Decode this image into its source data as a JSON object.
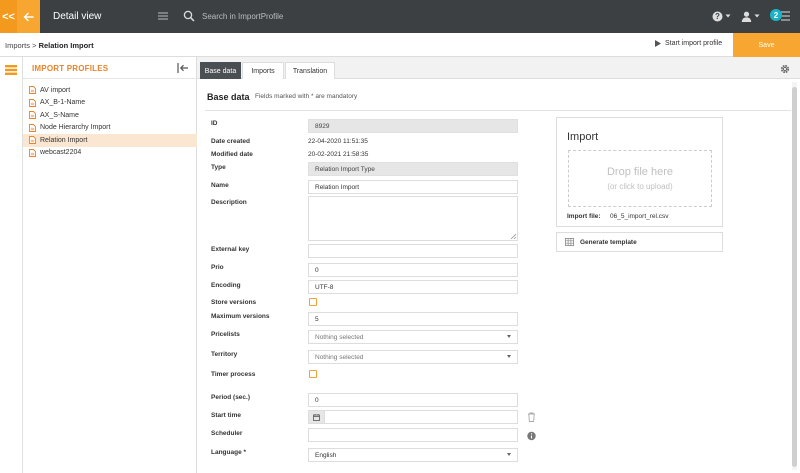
{
  "topbar": {
    "title": "Detail view",
    "collapse_label": "<<",
    "search_placeholder": "Search in ImportProfile",
    "notification_count": "2"
  },
  "breadcrumb": {
    "parent": "Imports",
    "separator": " > ",
    "current": "Relation Import"
  },
  "actions": {
    "start_label": "Start import profile",
    "save_label": "Save"
  },
  "sidebar": {
    "heading": "IMPORT PROFILES",
    "items": [
      {
        "label": "AV import"
      },
      {
        "label": "AX_B-1-Name"
      },
      {
        "label": "AX_S-Name"
      },
      {
        "label": "Node Hierarchy Import"
      },
      {
        "label": "Relation Import",
        "active": true
      },
      {
        "label": "webcast2204"
      }
    ]
  },
  "tabs": [
    {
      "label": "Base data",
      "active": true
    },
    {
      "label": "Imports"
    },
    {
      "label": "Translation"
    }
  ],
  "form": {
    "title": "Base data",
    "hint": "Fields marked with * are mandatory",
    "id_label": "ID",
    "id_value": "8929",
    "date_created_label": "Date created",
    "date_created_value": "22-04-2020 11:51:35",
    "modified_label": "Modified date",
    "modified_value": "20-02-2021 21:58:35",
    "type_label": "Type",
    "type_value": "Relation Import Type",
    "name_label": "Name",
    "name_value": "Relation Import",
    "description_label": "Description",
    "external_key_label": "External key",
    "prio_label": "Prio",
    "prio_value": "0",
    "encoding_label": "Encoding",
    "encoding_value": "UTF-8",
    "store_versions_label": "Store versions",
    "max_versions_label": "Maximum versions",
    "max_versions_value": "5",
    "pricelists_label": "Pricelists",
    "pricelists_value": "Nothing selected",
    "territory_label": "Territory",
    "territory_value": "Nothing selected",
    "timer_label": "Timer process",
    "period_label": "Period (sec.)",
    "period_value": "0",
    "start_time_label": "Start time",
    "scheduler_label": "Scheduler",
    "language_label": "Language *",
    "language_value": "English"
  },
  "import_card": {
    "title": "Import",
    "drop_main": "Drop file here",
    "drop_sub": "(or click to upload)",
    "file_label": "Import file:",
    "file_value": "06_5_import_rel.csv",
    "generate_label": "Generate template"
  },
  "colors": {
    "accent": "#f7a731",
    "topbar": "#3c4043",
    "sidebar_heading": "#e8832a",
    "active_tab": "#4a4f54",
    "badge": "#1ab3c7"
  }
}
